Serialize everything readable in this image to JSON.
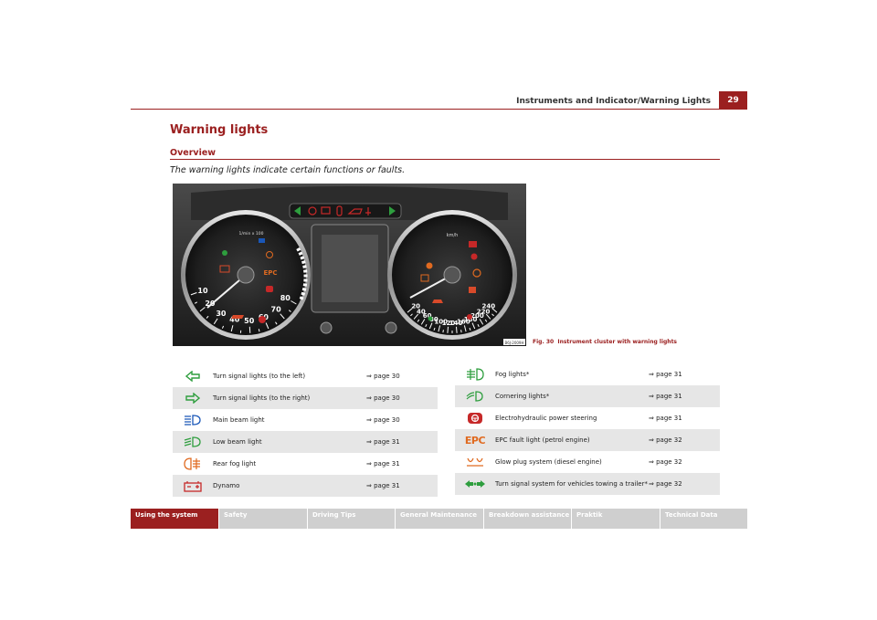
{
  "header": {
    "running_title": "Instruments and Indicator/Warning Lights",
    "page_number": "29"
  },
  "section_title": "Warning lights",
  "subsection_title": "Overview",
  "intro_text": "The warning lights indicate certain functions or faults.",
  "figure": {
    "code": "B6J-2009H",
    "caption_label": "Fig. 30",
    "caption_text": "Instrument cluster with warning lights",
    "left_gauge_ticks": [
      "10",
      "20",
      "30",
      "40",
      "50",
      "60",
      "70",
      "80"
    ],
    "left_gauge_unit": "1/min x 100",
    "right_gauge_ticks": [
      "20",
      "40",
      "60",
      "80",
      "100",
      "120",
      "140",
      "160",
      "180",
      "200",
      "220",
      "240"
    ],
    "right_gauge_unit": "km/h",
    "epc_text": "EPC"
  },
  "left_table": [
    {
      "icon": "turn-left-arrow-icon",
      "label": "Turn signal lights (to the left)",
      "ref": "⇒ page 30"
    },
    {
      "icon": "turn-right-arrow-icon",
      "label": "Turn signal lights (to the right)",
      "ref": "⇒ page 30"
    },
    {
      "icon": "main-beam-icon",
      "label": "Main beam light",
      "ref": "⇒ page 30"
    },
    {
      "icon": "low-beam-icon",
      "label": "Low beam light",
      "ref": "⇒ page 31"
    },
    {
      "icon": "rear-fog-light-icon",
      "label": "Rear fog light",
      "ref": "⇒ page 31"
    },
    {
      "icon": "battery-icon",
      "label": "Dynamo",
      "ref": "⇒ page 31"
    }
  ],
  "right_table": [
    {
      "icon": "fog-light-icon",
      "label": "Fog lights*",
      "ref": "⇒ page 31"
    },
    {
      "icon": "cornering-light-icon",
      "label": "Cornering lights*",
      "ref": "⇒ page 31"
    },
    {
      "icon": "steering-wheel-icon",
      "label": "Electrohydraulic power steering",
      "ref": "⇒ page 31"
    },
    {
      "icon": "epc-icon",
      "label": "EPC fault light (petrol engine)",
      "ref": "⇒ page 32",
      "icon_text": "EPC"
    },
    {
      "icon": "glow-plug-icon",
      "label": "Glow plug system (diesel engine)",
      "ref": "⇒ page 32"
    },
    {
      "icon": "trailer-turn-signal-icon",
      "label": "Turn signal system for vehicles towing a trailer*",
      "ref": "⇒ page 32"
    }
  ],
  "footer_tabs": [
    "Using the system",
    "Safety",
    "Driving Tips",
    "General Maintenance",
    "Breakdown assistance",
    "Praktik",
    "Technical Data"
  ],
  "colors": {
    "accent": "#9b2020",
    "icon_red": "#c62828",
    "icon_green": "#2e9e3e",
    "icon_blue": "#1a57b8",
    "table_stripe": "#e6e6e6"
  }
}
